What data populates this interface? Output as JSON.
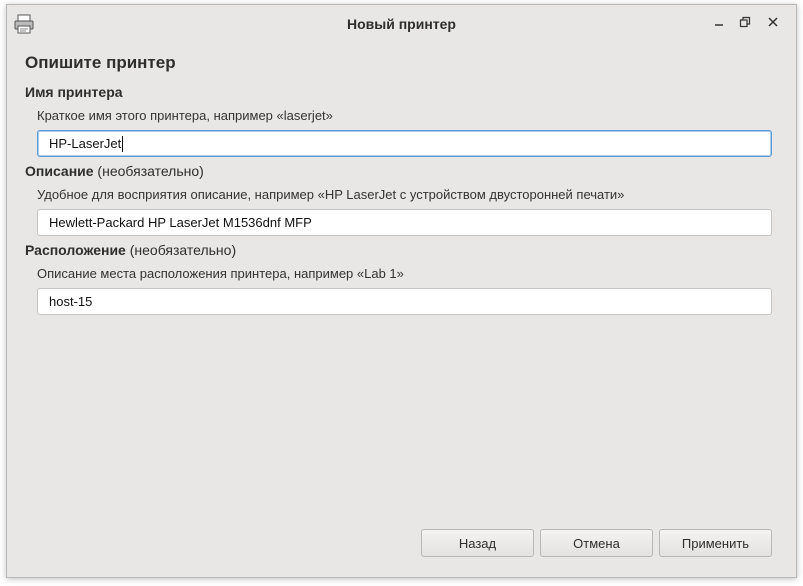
{
  "window": {
    "title": "Новый принтер",
    "app_icon": "printer-icon",
    "controls": [
      "minimize-icon",
      "maximize-icon",
      "close-icon"
    ]
  },
  "page": {
    "heading": "Опишите принтер"
  },
  "printer_name": {
    "label": "Имя принтера",
    "hint": "Краткое имя этого принтера, например «laserjet»",
    "value": "HP-LaserJet"
  },
  "description": {
    "label": "Описание",
    "optional": " (необязательно)",
    "hint": "Удобное для восприятия описание, например «HP LaserJet с устройством двусторонней печати»",
    "value": "Hewlett-Packard HP LaserJet M1536dnf MFP"
  },
  "location": {
    "label": "Расположение",
    "optional": " (необязательно)",
    "hint": "Описание места расположения принтера, например «Lab 1»",
    "value": "host-15"
  },
  "buttons": {
    "back": "Назад",
    "cancel": "Отмена",
    "apply": "Применить"
  },
  "colors": {
    "window_bg": "#e8e7e6",
    "focus_border": "#5b9bd5"
  }
}
